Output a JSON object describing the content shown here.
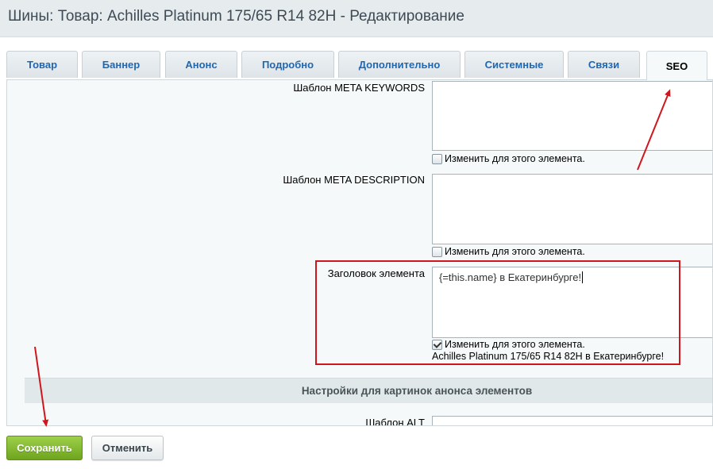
{
  "header": {
    "title": "Шины: Товар: Achilles Platinum 175/65 R14 82H - Редактирование"
  },
  "tabs": [
    {
      "label": "Товар",
      "active": false
    },
    {
      "label": "Баннер",
      "active": false
    },
    {
      "label": "Анонс",
      "active": false
    },
    {
      "label": "Подробно",
      "active": false
    },
    {
      "label": "Дополнительно",
      "active": false
    },
    {
      "label": "Системные",
      "active": false
    },
    {
      "label": "Связи",
      "active": false
    },
    {
      "label": "SEO",
      "active": true
    }
  ],
  "form": {
    "meta_keywords": {
      "label": "Шаблон META KEYWORDS",
      "value": "",
      "checkbox_label": "Изменить для этого элемента.",
      "checked": false
    },
    "meta_description": {
      "label": "Шаблон META DESCRIPTION",
      "value": "",
      "checkbox_label": "Изменить для этого элемента.",
      "checked": false
    },
    "element_title": {
      "label": "Заголовок элемента",
      "value": "{=this.name} в Екатеринбурге!",
      "checkbox_label": "Изменить для этого элемента.",
      "checked": true,
      "preview": "Achilles Platinum 175/65 R14 82H в Екатеринбурге!"
    },
    "section_header": "Настройки для картинок анонса элементов",
    "alt_template": {
      "label": "Шаблон ALT"
    }
  },
  "buttons": {
    "save": "Сохранить",
    "cancel": "Отменить"
  },
  "colors": {
    "accent_tab_text": "#2067b0",
    "annotation_red": "#d0161d",
    "save_green": "#7fb52a"
  }
}
